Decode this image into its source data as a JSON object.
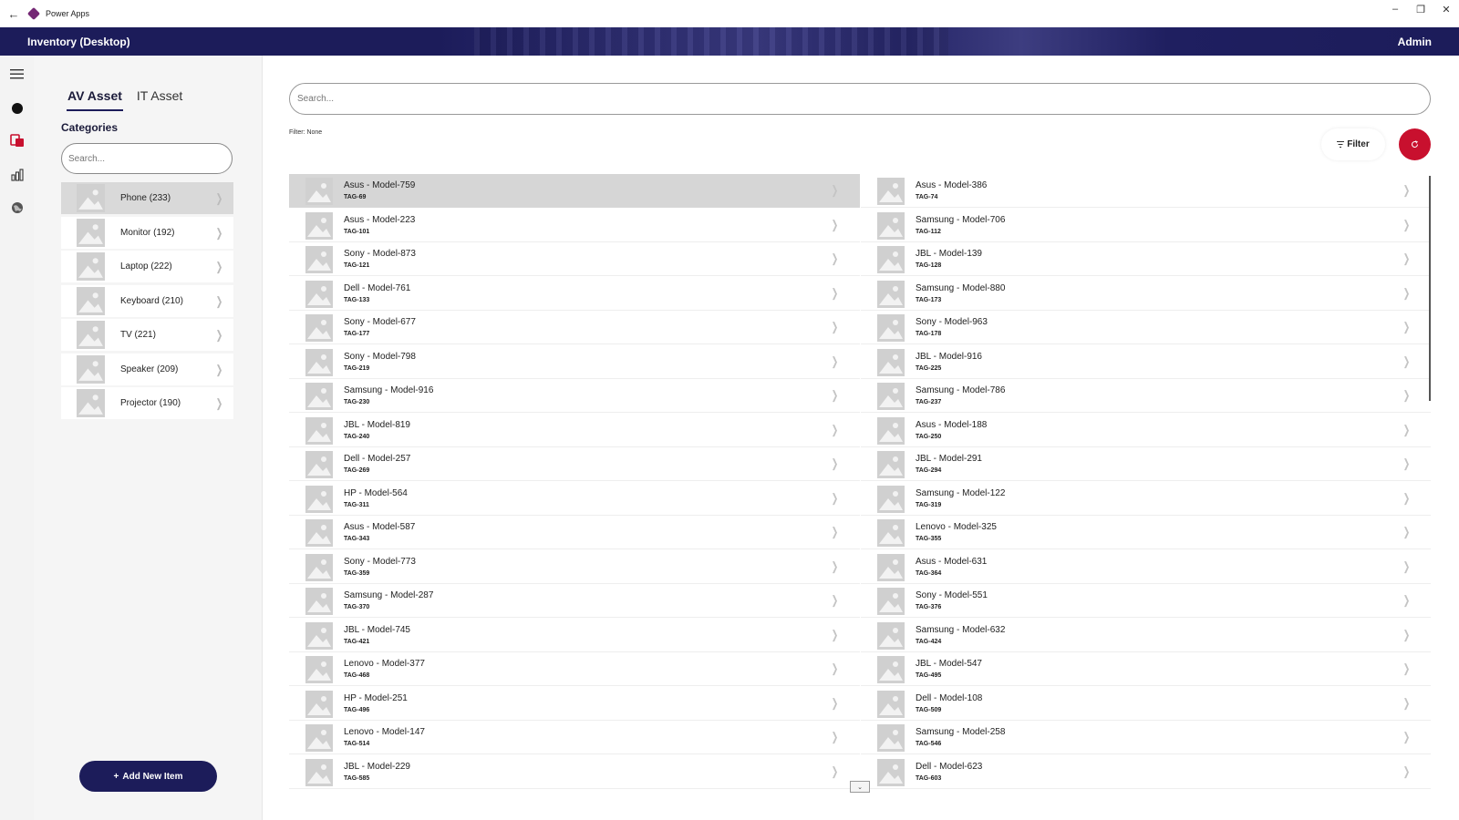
{
  "titlebar": {
    "app_name": "Power Apps",
    "back_icon": "back-arrow-icon",
    "window_buttons": [
      "minimize-icon",
      "restore-icon",
      "close-icon"
    ]
  },
  "header": {
    "title": "Inventory (Desktop)",
    "user": "Admin"
  },
  "rail": {
    "icons": [
      "hamburger-icon",
      "circle-icon",
      "devices-icon",
      "chart-icon",
      "globe-icon"
    ]
  },
  "left_panel": {
    "tabs": [
      {
        "label": "AV Asset",
        "active": true
      },
      {
        "label": "IT Asset",
        "active": false
      }
    ],
    "categories_heading": "Categories",
    "search_placeholder": "Search...",
    "categories": [
      {
        "label": "Phone (233)",
        "selected": true
      },
      {
        "label": "Monitor (192)",
        "selected": false
      },
      {
        "label": "Laptop (222)",
        "selected": false
      },
      {
        "label": "Keyboard (210)",
        "selected": false
      },
      {
        "label": "TV (221)",
        "selected": false
      },
      {
        "label": "Speaker (209)",
        "selected": false
      },
      {
        "label": "Projector (190)",
        "selected": false
      }
    ],
    "add_button": "Add New Item"
  },
  "main": {
    "search_placeholder": "Search...",
    "filter_status": "Filter: None",
    "filter_button": "Filter",
    "assets": [
      {
        "name": "Asus - Model-759",
        "tag": "TAG-69",
        "selected": true
      },
      {
        "name": "Asus - Model-386",
        "tag": "TAG-74"
      },
      {
        "name": "Asus - Model-223",
        "tag": "TAG-101"
      },
      {
        "name": "Samsung - Model-706",
        "tag": "TAG-112"
      },
      {
        "name": "Sony - Model-873",
        "tag": "TAG-121"
      },
      {
        "name": "JBL - Model-139",
        "tag": "TAG-128"
      },
      {
        "name": "Dell - Model-761",
        "tag": "TAG-133"
      },
      {
        "name": "Samsung - Model-880",
        "tag": "TAG-173"
      },
      {
        "name": "Sony - Model-677",
        "tag": "TAG-177"
      },
      {
        "name": "Sony - Model-963",
        "tag": "TAG-178"
      },
      {
        "name": "Sony - Model-798",
        "tag": "TAG-219"
      },
      {
        "name": "JBL - Model-916",
        "tag": "TAG-225"
      },
      {
        "name": "Samsung - Model-916",
        "tag": "TAG-230"
      },
      {
        "name": "Samsung - Model-786",
        "tag": "TAG-237"
      },
      {
        "name": "JBL - Model-819",
        "tag": "TAG-240"
      },
      {
        "name": "Asus - Model-188",
        "tag": "TAG-250"
      },
      {
        "name": "Dell - Model-257",
        "tag": "TAG-269"
      },
      {
        "name": "JBL - Model-291",
        "tag": "TAG-294"
      },
      {
        "name": "HP - Model-564",
        "tag": "TAG-311"
      },
      {
        "name": "Samsung - Model-122",
        "tag": "TAG-319"
      },
      {
        "name": "Asus - Model-587",
        "tag": "TAG-343"
      },
      {
        "name": "Lenovo - Model-325",
        "tag": "TAG-355"
      },
      {
        "name": "Sony - Model-773",
        "tag": "TAG-359"
      },
      {
        "name": "Asus - Model-631",
        "tag": "TAG-364"
      },
      {
        "name": "Samsung - Model-287",
        "tag": "TAG-370"
      },
      {
        "name": "Sony - Model-551",
        "tag": "TAG-376"
      },
      {
        "name": "JBL - Model-745",
        "tag": "TAG-421"
      },
      {
        "name": "Samsung - Model-632",
        "tag": "TAG-424"
      },
      {
        "name": "Lenovo - Model-377",
        "tag": "TAG-468"
      },
      {
        "name": "JBL - Model-547",
        "tag": "TAG-495"
      },
      {
        "name": "HP - Model-251",
        "tag": "TAG-496"
      },
      {
        "name": "Dell - Model-108",
        "tag": "TAG-509"
      },
      {
        "name": "Lenovo - Model-147",
        "tag": "TAG-514"
      },
      {
        "name": "Samsung - Model-258",
        "tag": "TAG-546"
      },
      {
        "name": "JBL - Model-229",
        "tag": "TAG-585"
      },
      {
        "name": "Dell - Model-623",
        "tag": "TAG-603"
      }
    ]
  },
  "colors": {
    "brand": "#1c1c5a",
    "accent": "#c8102e",
    "selected_row": "#d6d6d6"
  }
}
